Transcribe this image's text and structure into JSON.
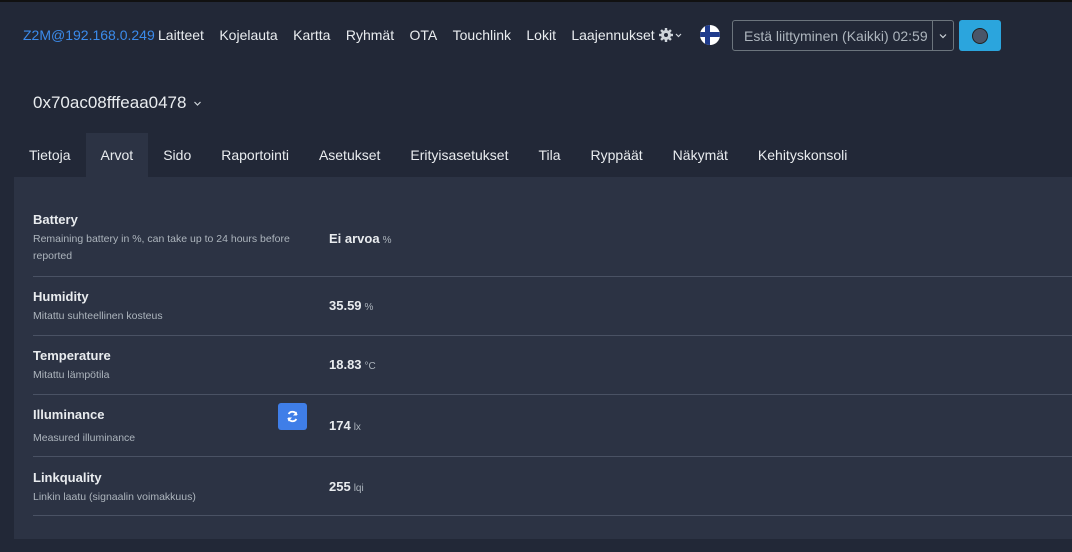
{
  "header": {
    "brand": "Z2M@192.168.0.249",
    "nav": [
      "Laitteet",
      "Kojelauta",
      "Kartta",
      "Ryhmät",
      "OTA",
      "Touchlink",
      "Lokit",
      "Laajennukset"
    ],
    "permit_join_label": "Estä liittyminen (Kaikki) 02:59",
    "accent": "#3b8beb"
  },
  "device": {
    "title": "0x70ac08fffeaa0478"
  },
  "tabs": [
    {
      "label": "Tietoja"
    },
    {
      "label": "Arvot",
      "active": true
    },
    {
      "label": "Sido"
    },
    {
      "label": "Raportointi"
    },
    {
      "label": "Asetukset"
    },
    {
      "label": "Erityisasetukset"
    },
    {
      "label": "Tila"
    },
    {
      "label": "Ryppäät"
    },
    {
      "label": "Näkymät"
    },
    {
      "label": "Kehityskonsoli"
    }
  ],
  "values": [
    {
      "name": "Battery",
      "desc": "Remaining battery in %, can take up to 24 hours before reported",
      "value": "Ei arvoa",
      "unit": "%"
    },
    {
      "name": "Humidity",
      "desc": "Mitattu suhteellinen kosteus",
      "value": "35.59",
      "unit": "%"
    },
    {
      "name": "Temperature",
      "desc": "Mitattu lämpötila",
      "value": "18.83",
      "unit": "°C"
    },
    {
      "name": "Illuminance",
      "desc": "Measured illuminance",
      "value": "174",
      "unit": "lx"
    },
    {
      "name": "Linkquality",
      "desc": "Linkin laatu (signaalin voimakkuus)",
      "value": "255",
      "unit": "lqi"
    }
  ]
}
